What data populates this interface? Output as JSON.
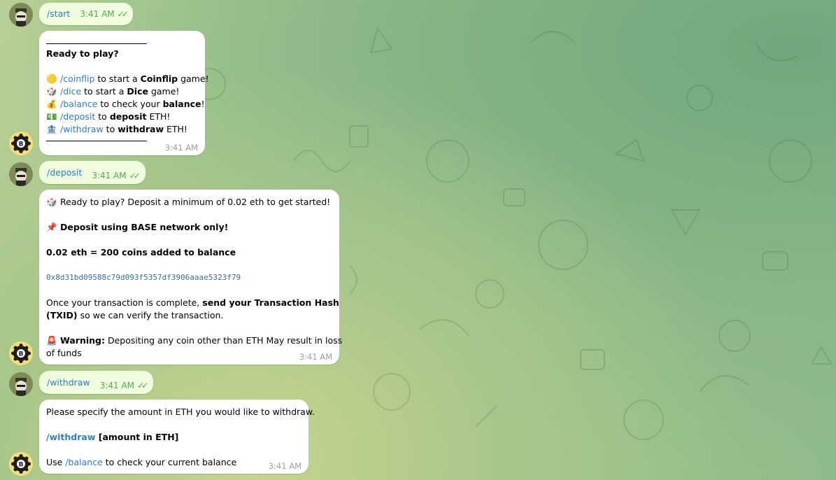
{
  "messages": {
    "start_cmd": {
      "text": "/start",
      "time": "3:41 AM"
    },
    "start_reply": {
      "heading": "Ready to play?",
      "lines": [
        {
          "emoji": "🟡",
          "cmd": "/coinflip",
          "pre": " to start a ",
          "bold": "Coinflip",
          "post": " game!"
        },
        {
          "emoji": "🎲",
          "cmd": "/dice",
          "pre": " to start a ",
          "bold": "Dice",
          "post": " game!"
        },
        {
          "emoji": "💰",
          "cmd": "/balance",
          "pre": " to check your ",
          "bold": "balance",
          "post": "!"
        },
        {
          "emoji": "💵",
          "cmd": "/deposit",
          "pre": " to ",
          "bold": "deposit",
          "post": " ETH!"
        },
        {
          "emoji": "🏦",
          "cmd": "/withdraw",
          "pre": " to ",
          "bold": "withdraw",
          "post": " ETH!"
        }
      ],
      "time": "3:41 AM"
    },
    "deposit_cmd": {
      "text": "/deposit",
      "time": "3:41 AM"
    },
    "deposit_reply": {
      "line1_emoji": "🎲",
      "line1": "Ready to play? Deposit a minimum of 0.02 eth to get started!",
      "line2_emoji": "📌",
      "line2": "Deposit using BASE network only!",
      "line3": "0.02 eth = 200 coins added to balance",
      "address": "0x8d31bd09588c79d093f5357df3906aaae5323f79",
      "line4_pre": "Once your transaction is complete, ",
      "line4_bold": "send your Transaction Hash",
      "line5_bold": "(TXID)",
      "line5_post": " so we can verify the transaction.",
      "warn_emoji": "🚨",
      "warn_bold": "Warning:",
      "warn_text": " Depositing any coin other than ETH May result in loss",
      "warn_text2": "of funds",
      "time": "3:41 AM"
    },
    "withdraw_cmd": {
      "text": "/withdraw",
      "time": "3:41 AM"
    },
    "withdraw_reply": {
      "line1": "Please specify the amount in ETH you would like to withdraw.",
      "cmd": "/withdraw",
      "cmd_arg": " [amount in ETH]",
      "use_pre": "Use ",
      "use_cmd": "/balance",
      "use_post": " to check your current balance",
      "time": "3:41 AM"
    }
  },
  "colors": {
    "accent": "#2f7fc1",
    "outgoing_bubble": "#effdde",
    "check": "#5aa65a"
  },
  "icons": {
    "read_receipt": "double-check-icon",
    "bot_avatar": "bot-avatar",
    "user_avatar": "user-avatar"
  }
}
